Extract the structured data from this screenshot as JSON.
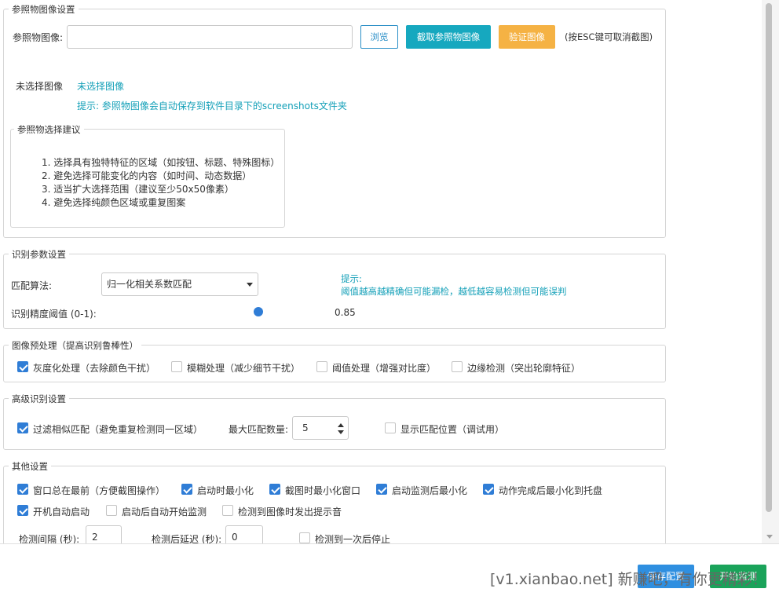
{
  "ref_group": {
    "legend": "参照物图像设置",
    "image_label": "参照物图像:",
    "image_path": "",
    "browse_btn": "浏览",
    "capture_btn": "截取参照物图像",
    "verify_btn": "验证图像",
    "esc_hint": "(按ESC键可取消截图)",
    "none_label": "未选择图像",
    "none_value": "未选择图像",
    "save_tip": "提示: 参照物图像会自动保存到软件目录下的screenshots文件夹",
    "advice": {
      "legend": "参照物选择建议",
      "items": [
        "1. 选择具有独特特征的区域（如按钮、标题、特殊图标）",
        "2. 避免选择可能变化的内容（如时间、动态数据）",
        "3. 适当扩大选择范围（建议至少50x50像素）",
        "4. 避免选择纯颜色区域或重复图案"
      ]
    }
  },
  "recog_group": {
    "legend": "识别参数设置",
    "algo_label": "匹配算法:",
    "algo_value": "归一化相关系数匹配",
    "tip_title": "提示:",
    "tip_text": "阈值越高越精确但可能漏检，越低越容易检测但可能误判",
    "threshold_label": "识别精度阈值 (0-1):",
    "threshold_value": "0.85",
    "threshold": 0.85
  },
  "preprocess_group": {
    "legend": "图像预处理（提高识别鲁棒性）",
    "options": [
      {
        "label": "灰度化处理（去除颜色干扰）",
        "checked": true
      },
      {
        "label": "模糊处理（减少细节干扰）",
        "checked": false
      },
      {
        "label": "阈值处理（增强对比度）",
        "checked": false
      },
      {
        "label": "边缘检测（突出轮廓特征）",
        "checked": false
      }
    ]
  },
  "advanced_group": {
    "legend": "高级识别设置",
    "filter_label": "过滤相似匹配（避免重复检测同一区域）",
    "filter_checked": true,
    "max_label": "最大匹配数量:",
    "max_value": "5",
    "show_pos_label": "显示匹配位置（调试用）",
    "show_pos_checked": false
  },
  "other_group": {
    "legend": "其他设置",
    "row1": [
      {
        "label": "窗口总在最前（方便截图操作）",
        "checked": true
      },
      {
        "label": "启动时最小化",
        "checked": true
      },
      {
        "label": "截图时最小化窗口",
        "checked": true
      },
      {
        "label": "启动监测后最小化",
        "checked": true
      },
      {
        "label": "动作完成后最小化到托盘",
        "checked": true
      }
    ],
    "row2": [
      {
        "label": "开机自动启动",
        "checked": true
      },
      {
        "label": "启动后自动开始监测",
        "checked": false
      },
      {
        "label": "检测到图像时发出提示音",
        "checked": false
      }
    ],
    "interval_label": "检测间隔 (秒):",
    "interval_value": "2",
    "delay_label": "检测后延迟 (秒):",
    "delay_value": "0",
    "stop_once_label": "检测到一次后停止",
    "stop_once_checked": false
  },
  "bottom": {
    "btn1": "保存配置",
    "btn2": "开始监测",
    "watermark": "[v1.xianbao.net] 新赚吧，有你更精彩！"
  },
  "colors": {
    "accent": "#2f7dd6",
    "teal": "#16a8bf",
    "orange": "#f5b244",
    "green": "#1aa35a"
  }
}
